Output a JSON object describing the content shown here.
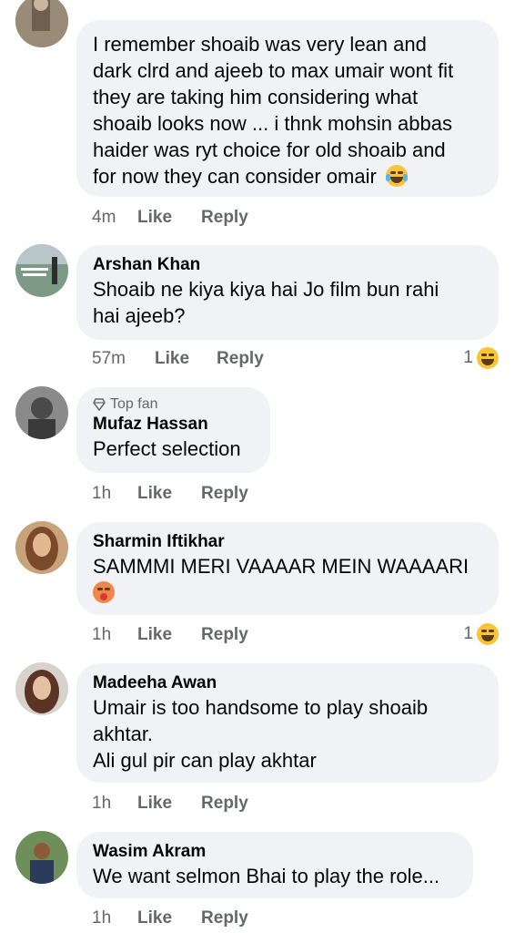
{
  "comments": [
    {
      "text": "I remember shoaib was very lean and\ndark clrd and ajeeb to max umair wont fit\nthey are taking him considering what\nshoaib looks now ... i thnk mohsin abbas\nhaider was ryt choice for old shoaib and\nfor now they can consider omair",
      "time": "4m",
      "like": "Like",
      "reply": "Reply"
    },
    {
      "author": "Arshan Khan",
      "text": "Shoaib ne kiya kiya hai Jo film bun rahi\nhai ajeeb?",
      "time": "57m",
      "like": "Like",
      "reply": "Reply",
      "reaction_count": "1"
    },
    {
      "badge": "Top fan",
      "author": "Mufaz Hassan",
      "text": "Perfect selection",
      "time": "1h",
      "like": "Like",
      "reply": "Reply"
    },
    {
      "author": "Sharmin Iftikhar",
      "text": "SAMMMI MERI VAAAAR MEIN WAAAARI",
      "time": "1h",
      "like": "Like",
      "reply": "Reply",
      "reaction_count": "1"
    },
    {
      "author": "Madeeha Awan",
      "text": "Umair is too handsome to play shoaib\nakhtar.\nAli gul pir can play akhtar",
      "time": "1h",
      "like": "Like",
      "reply": "Reply"
    },
    {
      "author": "Wasim Akram",
      "text": "We want selmon Bhai to play the role...",
      "time": "1h",
      "like": "Like",
      "reply": "Reply"
    }
  ],
  "colors": {
    "bubble": "#f0f2f5",
    "secondary_text": "#65676b",
    "primary_text": "#050505",
    "emoji_yellow": "#f7c538"
  }
}
